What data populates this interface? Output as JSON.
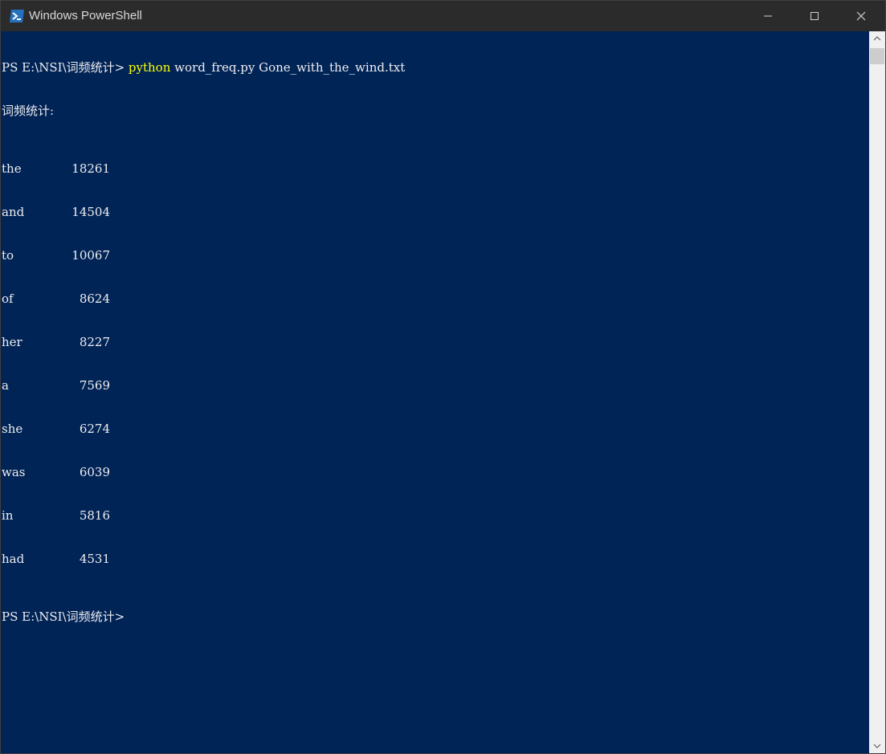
{
  "window": {
    "title": "Windows PowerShell",
    "icon": "powershell-icon"
  },
  "colors": {
    "background": "#012456",
    "text": "#eeedf0",
    "command": "#ffff00",
    "titlebar": "#2b2b2b"
  },
  "terminal": {
    "prompt": "PS E:\\NSI\\词频统计> ",
    "command_exe": "python",
    "command_args": " word_freq.py Gone_with_the_wind.txt",
    "header": "词频统计:",
    "results": [
      {
        "word": "the",
        "count": "18261"
      },
      {
        "word": "and",
        "count": "14504"
      },
      {
        "word": "to",
        "count": "10067"
      },
      {
        "word": "of",
        "count": "8624"
      },
      {
        "word": "her",
        "count": "8227"
      },
      {
        "word": "a",
        "count": "7569"
      },
      {
        "word": "she",
        "count": "6274"
      },
      {
        "word": "was",
        "count": "6039"
      },
      {
        "word": "in",
        "count": "5816"
      },
      {
        "word": "had",
        "count": "4531"
      }
    ],
    "final_prompt": "PS E:\\NSI\\词频统计>"
  }
}
